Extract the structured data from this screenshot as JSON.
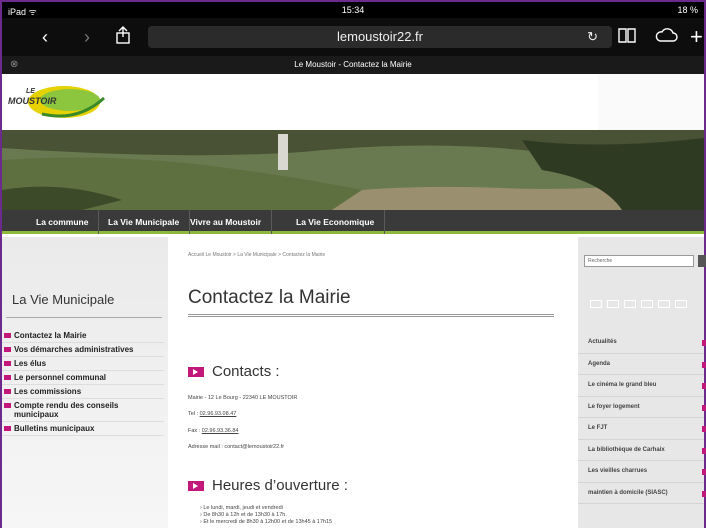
{
  "statusbar": {
    "device": "iPad ᯤ",
    "time": "15:34",
    "battery": "18 %"
  },
  "toolbar": {
    "url": "lemoustoir22.fr"
  },
  "tab": {
    "title": "Le Moustoir - Contactez la Mairie"
  },
  "logo": {
    "line1": "LE",
    "line2": "MOUSTOIR"
  },
  "nav": [
    {
      "label": "La commune"
    },
    {
      "label": "La Vie Municipale"
    },
    {
      "label": "Vivre au Moustoir"
    },
    {
      "label": "La Vie Economique"
    }
  ],
  "sidebar": {
    "title": "La Vie Municipale",
    "items": [
      {
        "label": "Contactez la Mairie"
      },
      {
        "label": "Vos démarches administratives"
      },
      {
        "label": "Les élus"
      },
      {
        "label": "Le personnel communal"
      },
      {
        "label": "Les commissions"
      },
      {
        "label": "Compte rendu des conseils municipaux"
      },
      {
        "label": "Bulletins municipaux"
      }
    ]
  },
  "main": {
    "breadcrumb": "Accueil Le Moustoir > La Vie Municipale > Contactez la Mairie",
    "title": "Contactez la Mairie",
    "contacts_heading": "Contacts :",
    "address": "Mairie - 12 Le Bourg - 22340 LE MOUSTOIR",
    "tel_label": "Tel : ",
    "tel": "02.96.93.08.47",
    "fax_label": "Fax : ",
    "fax": "02.96.93.36.84",
    "email": "Adresse mail : contact@lemoustoir22.fr",
    "hours_heading": "Heures d’ouverture :",
    "hours": [
      "› Le lundi, mardi, jeudi et vendredi",
      "› De 8h30 à 12h et de 13h30 à 17h.",
      "› Et le mercredi de 8h30 à 12h00 et de 13h45 à 17h15"
    ]
  },
  "right": {
    "search_placeholder": "Recherche",
    "links": [
      {
        "label": "Actualités"
      },
      {
        "label": "Agenda"
      },
      {
        "label": "Le cinéma le grand bleu"
      },
      {
        "label": "Le foyer logement"
      },
      {
        "label": "Le FJT"
      },
      {
        "label": "La bibliothèque de Carhaix"
      },
      {
        "label": "Les vieilles charrues"
      },
      {
        "label": "maintien à domicile (SIASC)"
      }
    ]
  },
  "colors": {
    "accent": "#c2187c",
    "nav_bg": "#3a3a3a",
    "nav_border": "#8cb83c",
    "frame": "#6b2a8c"
  }
}
